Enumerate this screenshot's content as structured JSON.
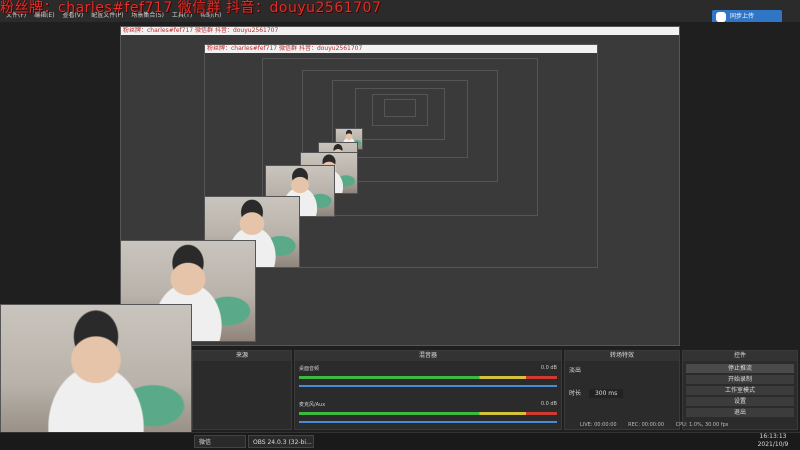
{
  "overlay_text": "粉丝牌：charles#fef717  微信群  抖音：douyu2561707",
  "app_title": "OBS 24.0.3 (32-bi...",
  "menu": [
    "文件(F)",
    "编辑(E)",
    "查看(V)",
    "配置文件(P)",
    "场景集合(S)",
    "工具(T)",
    "帮助(H)"
  ],
  "live_button_label": "同步上传",
  "docks": {
    "scenes_title": "来源",
    "mixer_title": "混音器",
    "transitions_title": "转场特效",
    "controls_title": "控件"
  },
  "mixer": [
    {
      "label": "桌面音频",
      "value": "0.0 dB"
    },
    {
      "label": "麦克风/Aux",
      "value": "0.0 dB"
    }
  ],
  "transition": {
    "duration_label": "时长",
    "duration_value": "300 ms",
    "type": "淡出"
  },
  "controls": [
    "停止推流",
    "开始录制",
    "工作室模式",
    "设置",
    "退出"
  ],
  "status": {
    "live": "LIVE: 00:00:00",
    "rec": "REC: 00:00:00",
    "cpu": "CPU: 1.0%, 30.00 fps"
  },
  "taskbar": {
    "item1": "微信",
    "item2": "OBS 24.0.3 (32-bi..."
  },
  "clock": {
    "time": "16:13:13",
    "date": "2021/10/9"
  },
  "nested_title": "粉丝牌：charles#fef717  微信群  抖音：douyu2561707"
}
